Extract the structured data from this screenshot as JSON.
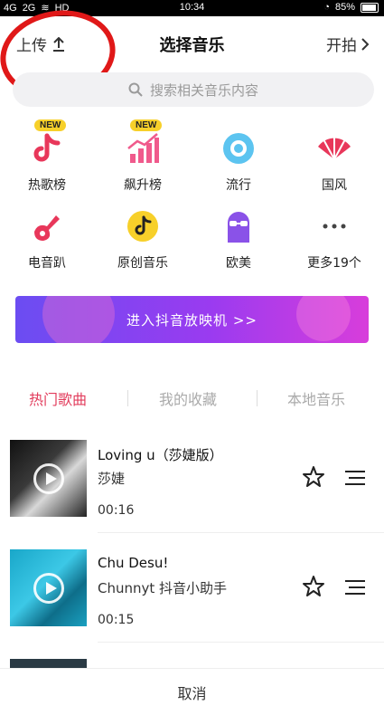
{
  "status": {
    "signal_left": "4G",
    "signal_right": "2G",
    "hd": "HD",
    "time": "10:34",
    "battery": "85%"
  },
  "header": {
    "upload": "上传",
    "title": "选择音乐",
    "shoot": "开拍"
  },
  "search": {
    "placeholder": "搜索相关音乐内容"
  },
  "categories": [
    {
      "label": "热歌榜",
      "badge": "NEW",
      "icon": "tiktok-note-icon"
    },
    {
      "label": "飙升榜",
      "badge": "NEW",
      "icon": "rising-chart-icon"
    },
    {
      "label": "流行",
      "icon": "disc-icon"
    },
    {
      "label": "国风",
      "icon": "fan-icon"
    },
    {
      "label": "电音趴",
      "icon": "guitar-icon"
    },
    {
      "label": "原创音乐",
      "icon": "tiktok-coin-icon"
    },
    {
      "label": "欧美",
      "icon": "avatar-glasses-icon"
    },
    {
      "label": "更多19个",
      "icon": "more-dots-icon"
    }
  ],
  "banner": {
    "text": "进入抖音放映机 >>"
  },
  "tabs": [
    {
      "label": "热门歌曲",
      "active": true
    },
    {
      "label": "我的收藏",
      "active": false
    },
    {
      "label": "本地音乐",
      "active": false
    }
  ],
  "songs": [
    {
      "name": "Loving u（莎婕版）",
      "artist": "莎婕",
      "duration": "00:16"
    },
    {
      "name": "Chu Desu!",
      "artist": "Chunnyt 抖音小助手",
      "duration": "00:15"
    }
  ],
  "footer": {
    "cancel": "取消"
  },
  "colors": {
    "accent_red": "#e23c5c",
    "badge_yellow": "#f7d02a",
    "banner_start": "#6b4df2",
    "banner_end": "#d83ddb",
    "annotation_red": "#e01818"
  }
}
